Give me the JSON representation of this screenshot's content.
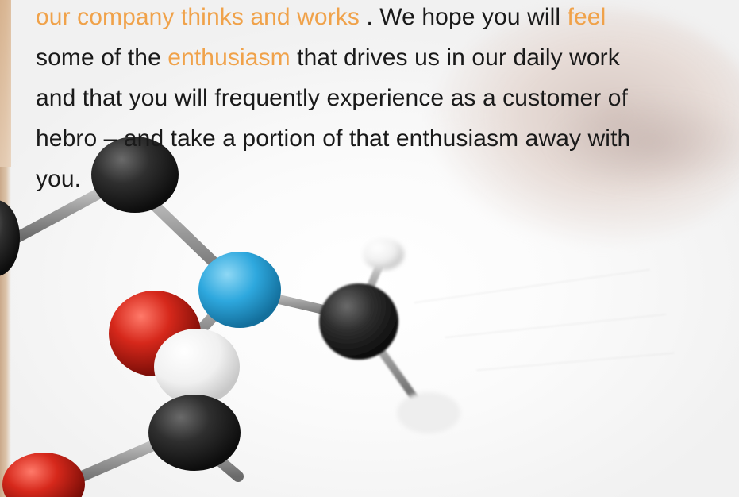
{
  "text": {
    "line1_a": "our company thinks and works",
    "line1_b": " . We hope you will ",
    "line1_c": "feel",
    "line2_a": "some of the ",
    "line2_b": "enthusiasm",
    "line2_c": " that drives us in our daily work",
    "line3": "and that you will frequently experience as a customer of",
    "line4": "hebro – and take a portion of that enthusiasm away with",
    "line5": "you."
  },
  "colors": {
    "text": "#1a1a1a",
    "highlight": "#f0a24a",
    "atom_black": "#2b2b2b",
    "atom_blue": "#2ea8de",
    "atom_red": "#d6281b",
    "atom_white": "#f2f2f2",
    "bond_grey": "#9a9a9a"
  },
  "image": {
    "subject": "molecular-model",
    "background": "blurred-hand-on-paper"
  }
}
